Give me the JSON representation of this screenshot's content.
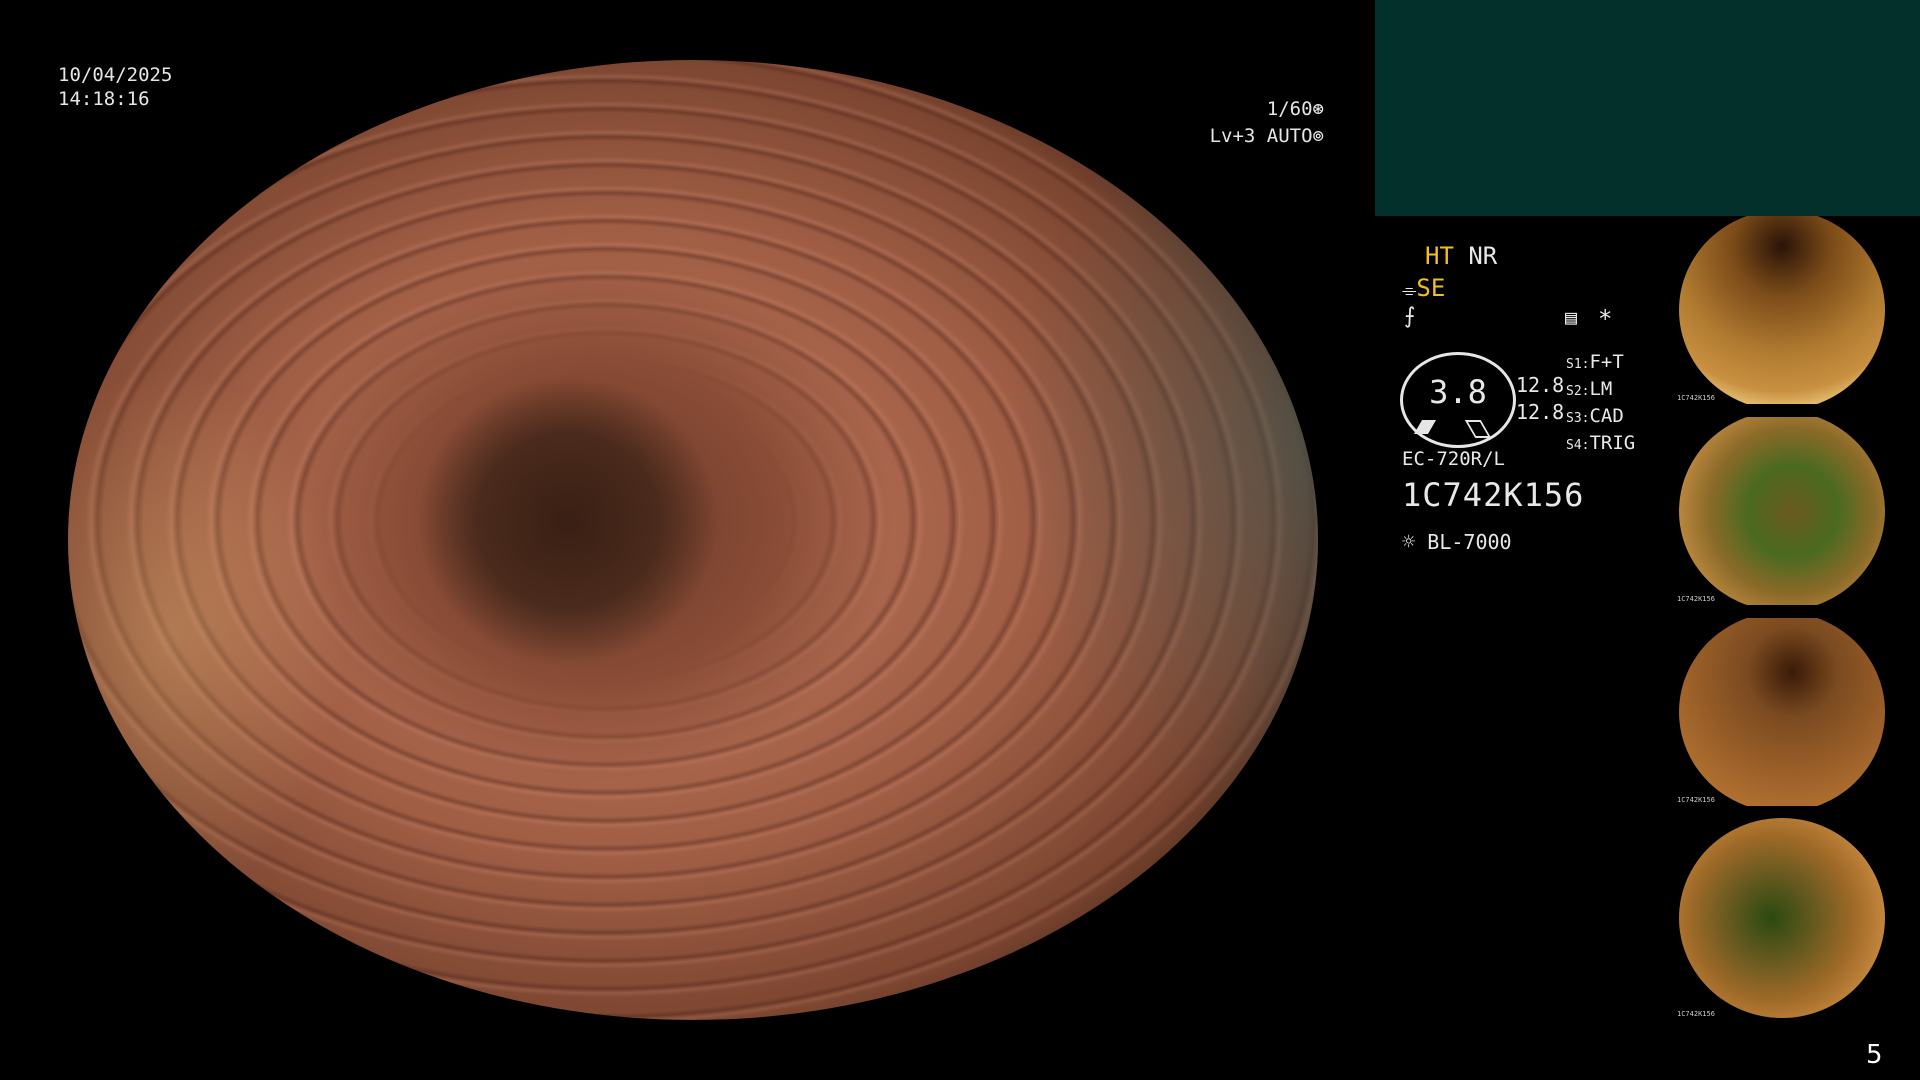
{
  "datetime": {
    "date": "10/04/2025",
    "time": "14:18:16"
  },
  "top_right": {
    "shutter": "1/60",
    "shutter_icon": "shutter-icon",
    "iris": "Lv+3 AUTO",
    "iris_icon": "iris-icon"
  },
  "panel": {
    "ht": "HT",
    "nr": "NR",
    "se": "SE",
    "se_icon": "enhancement-icon",
    "freq_icon": "frequency-icon",
    "doc_icon": "memo-icon",
    "asterisk": "*",
    "gauge_value": "3.8",
    "val1": "12.8",
    "val2": "12.8",
    "s_labels": [
      "S1",
      "S2",
      "S3",
      "S4"
    ],
    "s_values": [
      "F+T",
      "LM",
      "CAD",
      "TRIG"
    ],
    "scope_model": "EC-720R/L",
    "serial": "1C742K156",
    "light_icon": "light-source-icon",
    "light_source": "BL-7000"
  },
  "thumbnails": [
    {
      "caption": "1C742K156"
    },
    {
      "caption": "1C742K156"
    },
    {
      "caption": "1C742K156"
    },
    {
      "caption": "1C742K156"
    }
  ],
  "page_number": "5"
}
